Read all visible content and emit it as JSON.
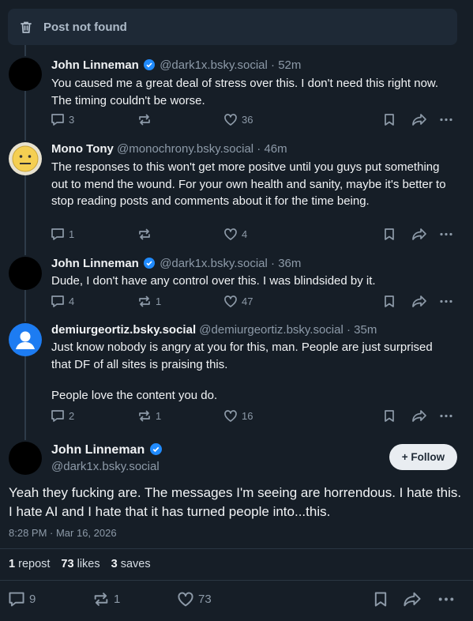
{
  "deleted_notice": {
    "label": "Post not found"
  },
  "replies": [
    {
      "name": "John Linneman",
      "verified": true,
      "handle": "@dark1x.bsky.social",
      "time": "· 52m",
      "text": "You caused me a great deal of stress over this. I don't need this right now. The timing couldn't be worse.",
      "replies": "3",
      "reposts": "",
      "likes": "36"
    },
    {
      "name": "Mono Tony",
      "verified": false,
      "handle": "@monochrony.bsky.social",
      "time": "· 46m",
      "text": "The responses to this won't get more positve until you guys put something out to mend the wound. For your own health and sanity, maybe it's better to stop reading posts and comments about it for the time being.",
      "replies": "1",
      "reposts": "",
      "likes": "4"
    },
    {
      "name": "John Linneman",
      "verified": true,
      "handle": "@dark1x.bsky.social",
      "time": "· 36m",
      "text": "Dude, I don't have any control over this. I was blindsided by it.",
      "replies": "4",
      "reposts": "1",
      "likes": "47"
    },
    {
      "name": "demiurgeortiz.bsky.social",
      "verified": false,
      "handle": "@demiurgeortiz.bsky.social",
      "time": "· 35m",
      "text": "Just know nobody is angry at you for this, man. People are just surprised that DF of all sites is praising this.",
      "text2": "People love the content you do.",
      "replies": "2",
      "reposts": "1",
      "likes": "16"
    }
  ],
  "main_post": {
    "name": "John Linneman",
    "verified": true,
    "handle": "@dark1x.bsky.social",
    "follow_label": "+ Follow",
    "text": "Yeah they fucking are. The messages I'm seeing are horrendous. I hate this. I hate AI and I hate that it has turned people into...this.",
    "timestamp": "8:28 PM · Mar 16, 2026",
    "stats": {
      "reposts_count": "1",
      "reposts_label": "repost",
      "likes_count": "73",
      "likes_label": "likes",
      "saves_count": "3",
      "saves_label": "saves"
    },
    "replies": "9",
    "reposts": "1",
    "likes": "73"
  },
  "colors": {
    "background": "#161e27",
    "verified": "#208bfe",
    "muted": "#8d9aa8"
  }
}
